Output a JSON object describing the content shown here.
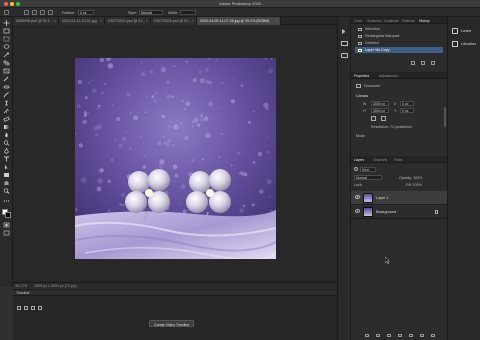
{
  "window": {
    "title": "Adobe Photoshop 2020"
  },
  "options_bar": {
    "feather_label": "Feather:",
    "feather_value": "0 px",
    "style_label": "Style:",
    "style_value": "Normal",
    "width_label": "Width:"
  },
  "doc_tabs": [
    {
      "label": "IZM0096.psd @ 95.1...",
      "active": false
    },
    {
      "label": "2020-04-15-15-51.jpg",
      "active": false
    },
    {
      "label": "DSCF0004.psd @ 91...",
      "active": false
    },
    {
      "label": "DSCF0026.psd @ 91...",
      "active": false
    },
    {
      "label": "2020-04-05-11-07-28.jpg @ 35.2% (RGB/8)",
      "active": true
    }
  ],
  "status_bar": {
    "zoom": "35.17%",
    "doc_info": "3000 px x 3000 px (72 ppi)"
  },
  "timeline": {
    "title": "Timeline",
    "create_button": "Create Video Timeline"
  },
  "panels": {
    "top_tabs": [
      "Color",
      "Swatches",
      "Gradients",
      "Patterns",
      "History"
    ],
    "history": {
      "items": [
        {
          "label": "Selection"
        },
        {
          "label": "Rectangular Marquee"
        },
        {
          "label": "Deselect"
        },
        {
          "label": "Layer Via Copy",
          "selected": true
        }
      ]
    },
    "properties": {
      "tabs": [
        "Properties",
        "Adjustments"
      ],
      "doc_label": "Document",
      "section": "Canvas",
      "w_label": "W",
      "w_value": "3000 px",
      "h_label": "H",
      "h_value": "3000 px",
      "x_label": "X",
      "x_value": "0 px",
      "y_label": "Y",
      "y_value": "0 px",
      "resolution": "Resolution: 72 pixels/inch",
      "mode": "Mode"
    },
    "layers": {
      "tabs": [
        "Layers",
        "Channels",
        "Paths"
      ],
      "filter_label": "Kind",
      "blend_mode": "Normal",
      "opacity_label": "Opacity: 100%",
      "lock_label": "Lock:",
      "fill_label": "Fill: 100%",
      "items": [
        {
          "name": "Layer 1",
          "selected": true
        },
        {
          "name": "Background",
          "selected": false
        }
      ]
    }
  },
  "learn_column": {
    "items": [
      {
        "label": "Learn"
      },
      {
        "label": "Libraries"
      }
    ]
  },
  "colors": {
    "accent": "#3e5e86",
    "canvas_bg": "#282828",
    "panel_bg": "#2c2c2c"
  }
}
